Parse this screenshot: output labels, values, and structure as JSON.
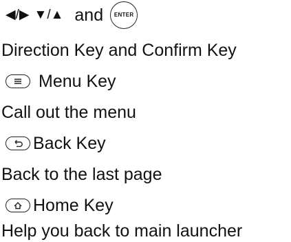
{
  "keys": {
    "direction": {
      "arrows_lr": "◀/▶",
      "arrows_ud": "▼/▲",
      "connector": "and",
      "enter_label": "ENTER",
      "title": "Direction Key and Confirm Key"
    },
    "menu": {
      "title": "Menu Key",
      "description": "Call out the menu",
      "icon": "menu-key-icon"
    },
    "back": {
      "title": "Back Key",
      "description": "Back to the last page",
      "icon": "back-key-icon"
    },
    "home": {
      "title": "Home Key",
      "description": "Help you back to main launcher",
      "icon": "home-key-icon"
    }
  }
}
